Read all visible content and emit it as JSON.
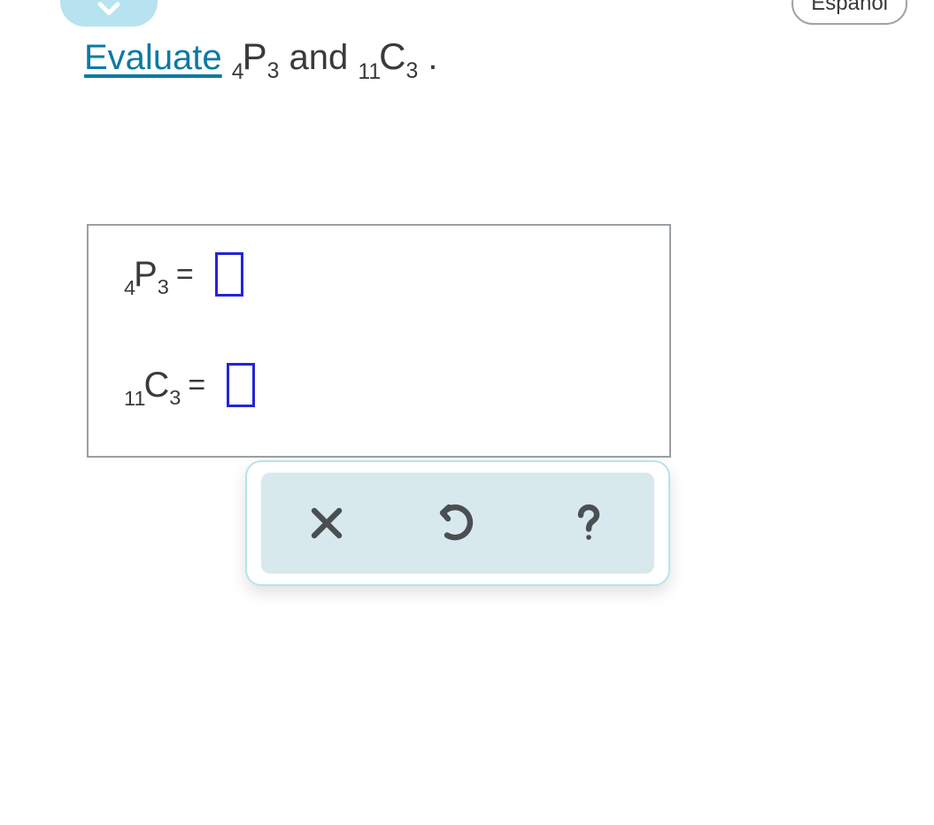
{
  "header": {
    "language_label": "Español"
  },
  "question": {
    "link_word": "Evaluate",
    "expr1": {
      "pre": "4",
      "letter": "P",
      "post": "3"
    },
    "join_word": " and ",
    "expr2": {
      "pre": "11",
      "letter": "C",
      "post": "3"
    },
    "terminator": "."
  },
  "answers": {
    "row1": {
      "pre": "4",
      "letter": "P",
      "post": "3",
      "eq": "=",
      "value": ""
    },
    "row2": {
      "pre": "11",
      "letter": "C",
      "post": "3",
      "eq": "=",
      "value": ""
    }
  },
  "toolbar": {
    "clear": "clear",
    "undo": "undo",
    "help": "help"
  }
}
